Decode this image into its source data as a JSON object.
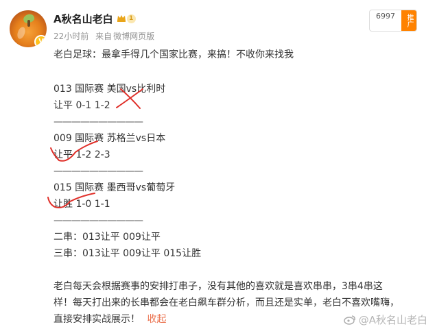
{
  "header": {
    "username": "A秋名山老白",
    "level": "1",
    "time": "22小时前",
    "source_prefix": "来自",
    "source": "微博网页版"
  },
  "follow": {
    "count": "6997",
    "label": "推广"
  },
  "post": {
    "intro": "老白足球：最拿手得几个国家比赛，来搞！不收你来找我",
    "matches": [
      {
        "title": "013 国际赛 美国vs比利时",
        "pick": "让平 0-1 1-2"
      },
      {
        "title": "009 国际赛 苏格兰vs日本",
        "pick": "让平 1-2 2-3"
      },
      {
        "title": "015 国际赛 墨西哥vs葡萄牙",
        "pick": "让胜 1-0 1-1"
      }
    ],
    "separator": "——————————",
    "parlay2": "二串：013让平 009让平",
    "parlay3": "三串：013让平 009让平 015让胜",
    "body_line1": "老白每天会根据赛事的安排打串子，没有其他的喜欢就是喜欢串串，3串4串这",
    "body_line2": "样！每天打出来的长串都会在老白飙车群分析，而且还是实单，老白不喜欢嘴嗨，",
    "body_line3": "直接安排实战展示！",
    "collapse": "收起"
  },
  "watermark": "@A秋名山老白"
}
